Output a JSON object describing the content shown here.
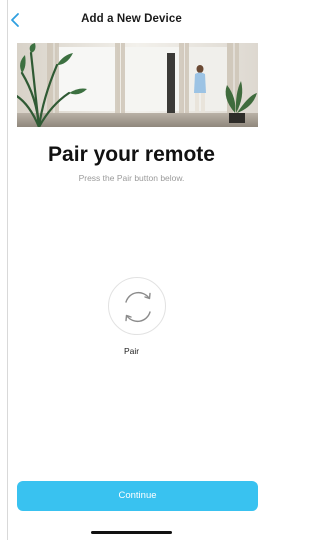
{
  "header": {
    "title": "Add a New Device",
    "back_icon": "chevron-left-icon"
  },
  "hero": {
    "image": "living-room-photo"
  },
  "main": {
    "title": "Pair your remote",
    "subtitle": "Press the Pair button below.",
    "pair_icon": "refresh-icon",
    "pair_label": "Pair"
  },
  "footer": {
    "continue_label": "Continue"
  },
  "colors": {
    "accent": "#39c2f0",
    "back_icon": "#2f9fe0",
    "title_text": "#111111",
    "subtitle_text": "#9a9a9a"
  }
}
